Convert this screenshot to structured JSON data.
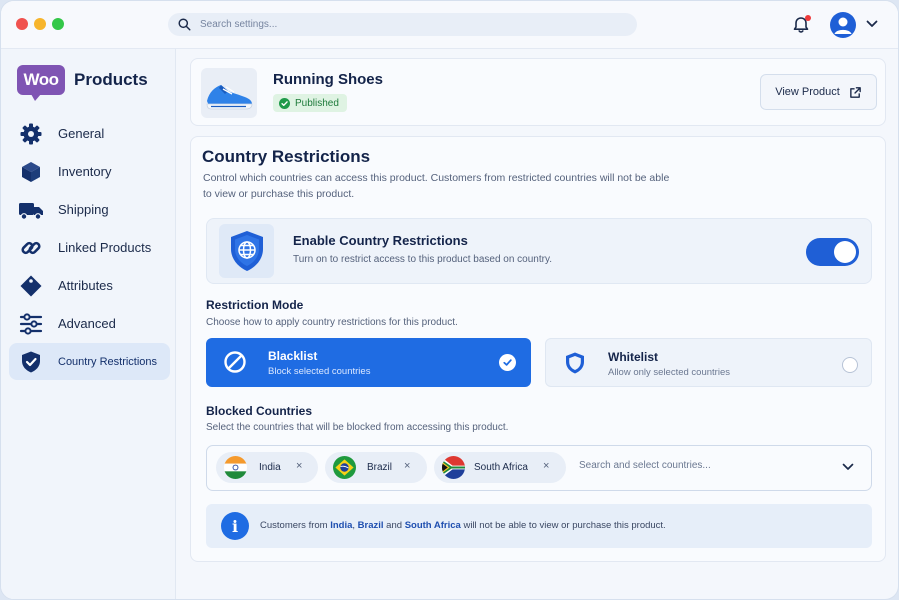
{
  "topbar": {
    "search_placeholder": "Search settings...",
    "notification_badge_color": "#ee3b3b"
  },
  "sidebar": {
    "logo_text": "Woo",
    "title": "Products",
    "items": [
      {
        "label": "General",
        "icon": "gear-icon"
      },
      {
        "label": "Inventory",
        "icon": "box-icon"
      },
      {
        "label": "Shipping",
        "icon": "truck-icon"
      },
      {
        "label": "Linked Products",
        "icon": "link-icon"
      },
      {
        "label": "Attributes",
        "icon": "tag-icon"
      },
      {
        "label": "Advanced",
        "icon": "sliders-icon"
      },
      {
        "label": "Country Restrictions",
        "icon": "shield-check-icon",
        "active": true
      }
    ]
  },
  "product": {
    "name": "Running Shoes",
    "status": "Published",
    "view_button": "View Product"
  },
  "restrictions": {
    "title": "Country Restrictions",
    "description": "Control which countries can access this product. Customers from restricted countries will not be able to view or purchase this product.",
    "enable": {
      "title": "Enable Country Restrictions",
      "description": "Turn on to restrict access to this product based on country.",
      "enabled": true
    },
    "mode": {
      "title": "Restriction Mode",
      "description": "Choose how to apply country restrictions for this product.",
      "options": [
        {
          "title": "Blacklist",
          "description": "Block selected countries",
          "selected": true
        },
        {
          "title": "Whitelist",
          "description": "Allow only selected countries",
          "selected": false
        }
      ]
    },
    "blocked": {
      "title": "Blocked Countries",
      "description": "Select the countries that will be blocked from accessing this product.",
      "countries": [
        "India",
        "Brazil",
        "South Africa"
      ],
      "remove_glyph": "×",
      "search_placeholder": "Search and select countries..."
    },
    "info": {
      "icon_glyph": "i",
      "prefix": "Customers from ",
      "country_1": "India",
      "sep_1": ", ",
      "country_2": "Brazil",
      "sep_2": " and ",
      "country_3": "South Africa",
      "suffix": " will not be able to view or purchase this product."
    }
  },
  "colors": {
    "accent": "#1f6ce3",
    "toggle_on": "#1f5fd6",
    "published_green": "#1d7a3a",
    "woo_purple": "#7f54b3"
  }
}
